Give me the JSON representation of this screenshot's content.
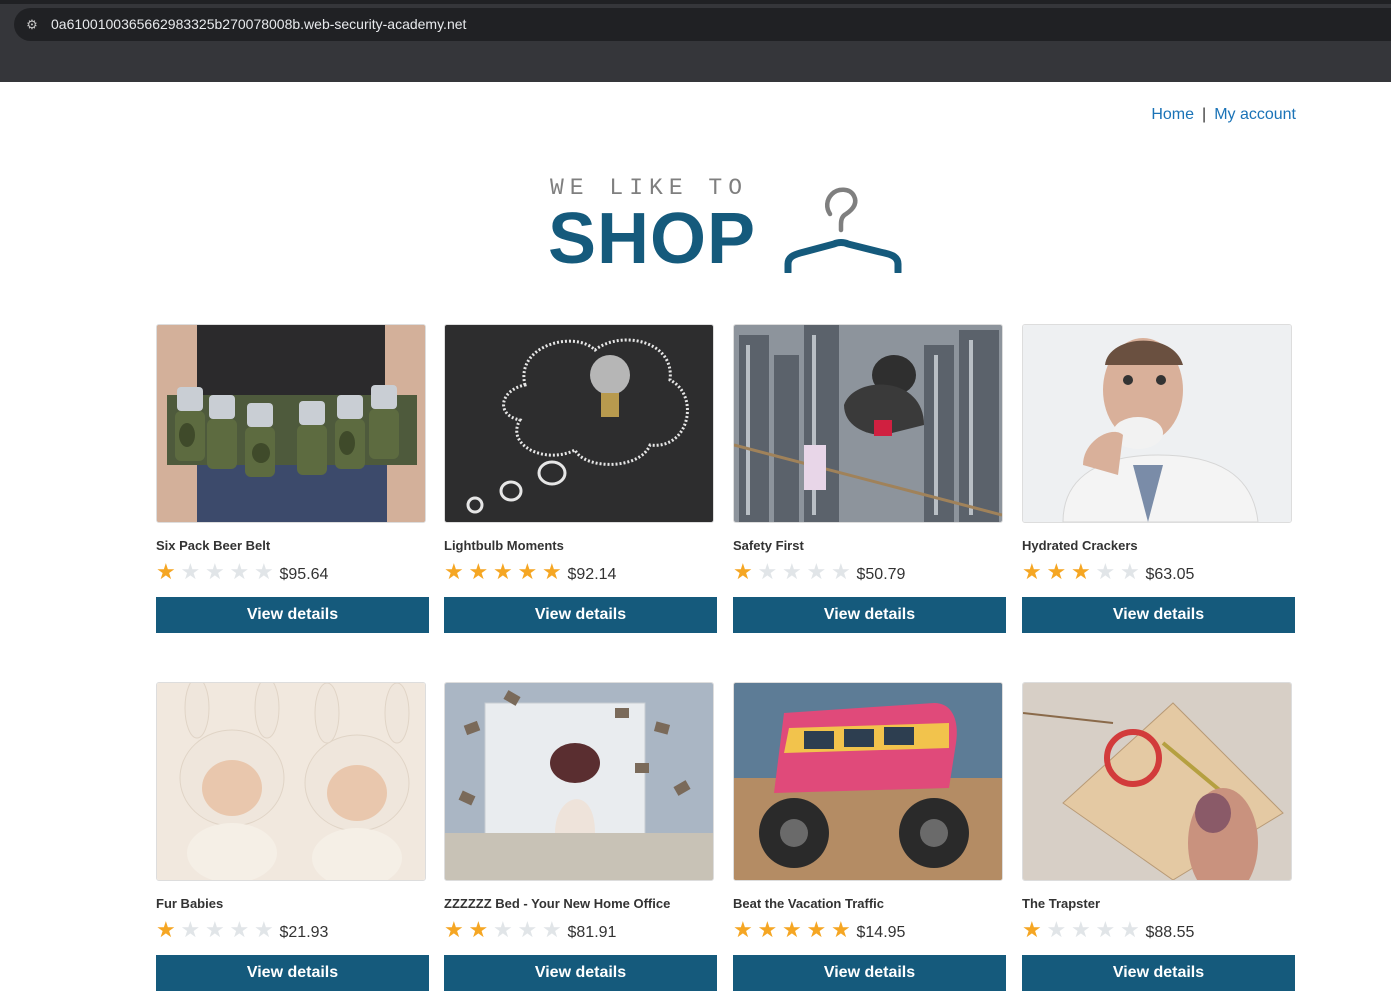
{
  "browser": {
    "url": "0a6100100365662983325b270078008b.web-security-academy.net"
  },
  "nav": {
    "home": "Home",
    "separator": "|",
    "account": "My account"
  },
  "logo": {
    "tagline": "WE LIKE TO",
    "word": "SHOP"
  },
  "colors": {
    "brand": "#155a7c",
    "link": "#1a73b7",
    "star": "#f5a623"
  },
  "button_label": "View details",
  "products": [
    {
      "title": "Six Pack Beer Belt",
      "stars": 1,
      "price": "$95.64",
      "image": "beer-belt-photo"
    },
    {
      "title": "Lightbulb Moments",
      "stars": 5,
      "price": "$92.14",
      "image": "lightbulb-chalkboard-photo"
    },
    {
      "title": "Safety First",
      "stars": 1,
      "price": "$50.79",
      "image": "city-tightrope-photo"
    },
    {
      "title": "Hydrated Crackers",
      "stars": 3,
      "price": "$63.05",
      "image": "man-eating-cracker-photo"
    },
    {
      "title": "Fur Babies",
      "stars": 1,
      "price": "$21.93",
      "image": "babies-bunny-hats-photo"
    },
    {
      "title": "ZZZZZZ Bed - Your New Home Office",
      "stars": 2,
      "price": "$81.91",
      "image": "flying-books-bed-photo"
    },
    {
      "title": "Beat the Vacation Traffic",
      "stars": 5,
      "price": "$14.95",
      "image": "monster-van-photo"
    },
    {
      "title": "The Trapster",
      "stars": 1,
      "price": "$88.55",
      "image": "mousetrap-finger-photo"
    }
  ]
}
